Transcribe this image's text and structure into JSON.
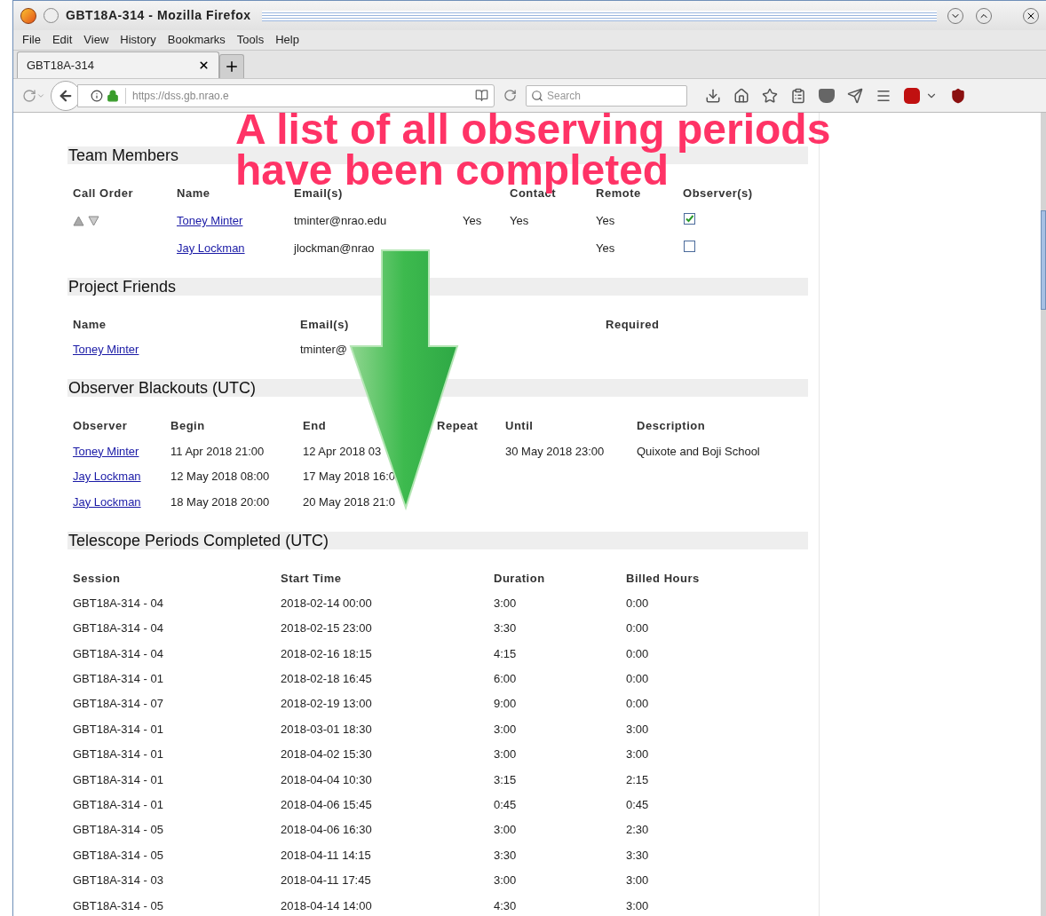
{
  "window": {
    "title": "GBT18A-314 - Mozilla Firefox"
  },
  "menu": [
    "File",
    "Edit",
    "View",
    "History",
    "Bookmarks",
    "Tools",
    "Help"
  ],
  "tabs": [
    {
      "label": "GBT18A-314",
      "selected": true
    }
  ],
  "address_bar": {
    "url": "https://dss.gb.nrao.e"
  },
  "search": {
    "placeholder": "Search"
  },
  "team_members": {
    "heading": "Team Members",
    "headers": {
      "call_order": "Call Order",
      "name": "Name",
      "email": "Email(s)",
      "contact": "Contact",
      "remote": "Remote",
      "observer": "Observer(s)"
    },
    "rows": [
      {
        "name": "Toney Minter",
        "email": "tminter@nrao.edu",
        "column_4": "Yes",
        "contact": "Yes",
        "remote": "Yes",
        "observer": true
      },
      {
        "name": "Jay Lockman",
        "email": "jlockman@nrao",
        "remote": "Yes",
        "observer": false
      }
    ]
  },
  "project_friends": {
    "heading": "Project Friends",
    "columns": [
      "Name",
      "Email(s)",
      "Required"
    ],
    "rows": [
      {
        "name": "Toney Minter",
        "email": "tminter@"
      }
    ]
  },
  "observer_blackouts": {
    "heading": "Observer Blackouts (UTC)",
    "columns": [
      "Observer",
      "Begin",
      "End",
      "Repeat",
      "Until",
      "Description"
    ],
    "rows": [
      {
        "observer": "Toney Minter",
        "begin": "11 Apr 2018 21:00",
        "end": "12 Apr 2018 03",
        "until": "30 May 2018 23:00",
        "description": "Quixote and Boji School"
      },
      {
        "observer": "Jay Lockman",
        "begin": "12 May 2018 08:00",
        "end": "17 May 2018 16:0"
      },
      {
        "observer": "Jay Lockman",
        "begin": "18 May 2018 20:00",
        "end": "20 May 2018 21:0"
      }
    ]
  },
  "telescope_periods": {
    "heading": "Telescope Periods Completed (UTC)",
    "columns": [
      "Session",
      "Start Time",
      "Duration",
      "Billed Hours"
    ],
    "rows": [
      [
        "GBT18A-314 - 04",
        "2018-02-14 00:00",
        "3:00",
        "0:00"
      ],
      [
        "GBT18A-314 - 04",
        "2018-02-15 23:00",
        "3:30",
        "0:00"
      ],
      [
        "GBT18A-314 - 04",
        "2018-02-16 18:15",
        "4:15",
        "0:00"
      ],
      [
        "GBT18A-314 - 01",
        "2018-02-18 16:45",
        "6:00",
        "0:00"
      ],
      [
        "GBT18A-314 - 07",
        "2018-02-19 13:00",
        "9:00",
        "0:00"
      ],
      [
        "GBT18A-314 - 01",
        "2018-03-01 18:30",
        "3:00",
        "3:00"
      ],
      [
        "GBT18A-314 - 01",
        "2018-04-02 15:30",
        "3:00",
        "3:00"
      ],
      [
        "GBT18A-314 - 01",
        "2018-04-04 10:30",
        "3:15",
        "2:15"
      ],
      [
        "GBT18A-314 - 01",
        "2018-04-06 15:45",
        "0:45",
        "0:45"
      ],
      [
        "GBT18A-314 - 05",
        "2018-04-06 16:30",
        "3:00",
        "2:30"
      ],
      [
        "GBT18A-314 - 05",
        "2018-04-11 14:15",
        "3:30",
        "3:30"
      ],
      [
        "GBT18A-314 - 03",
        "2018-04-11 17:45",
        "3:00",
        "3:00"
      ],
      [
        "GBT18A-314 - 05",
        "2018-04-14 14:00",
        "4:30",
        "3:00"
      ]
    ]
  },
  "annotation": {
    "lines": [
      "A list of all observing periods",
      "have been completed"
    ]
  }
}
